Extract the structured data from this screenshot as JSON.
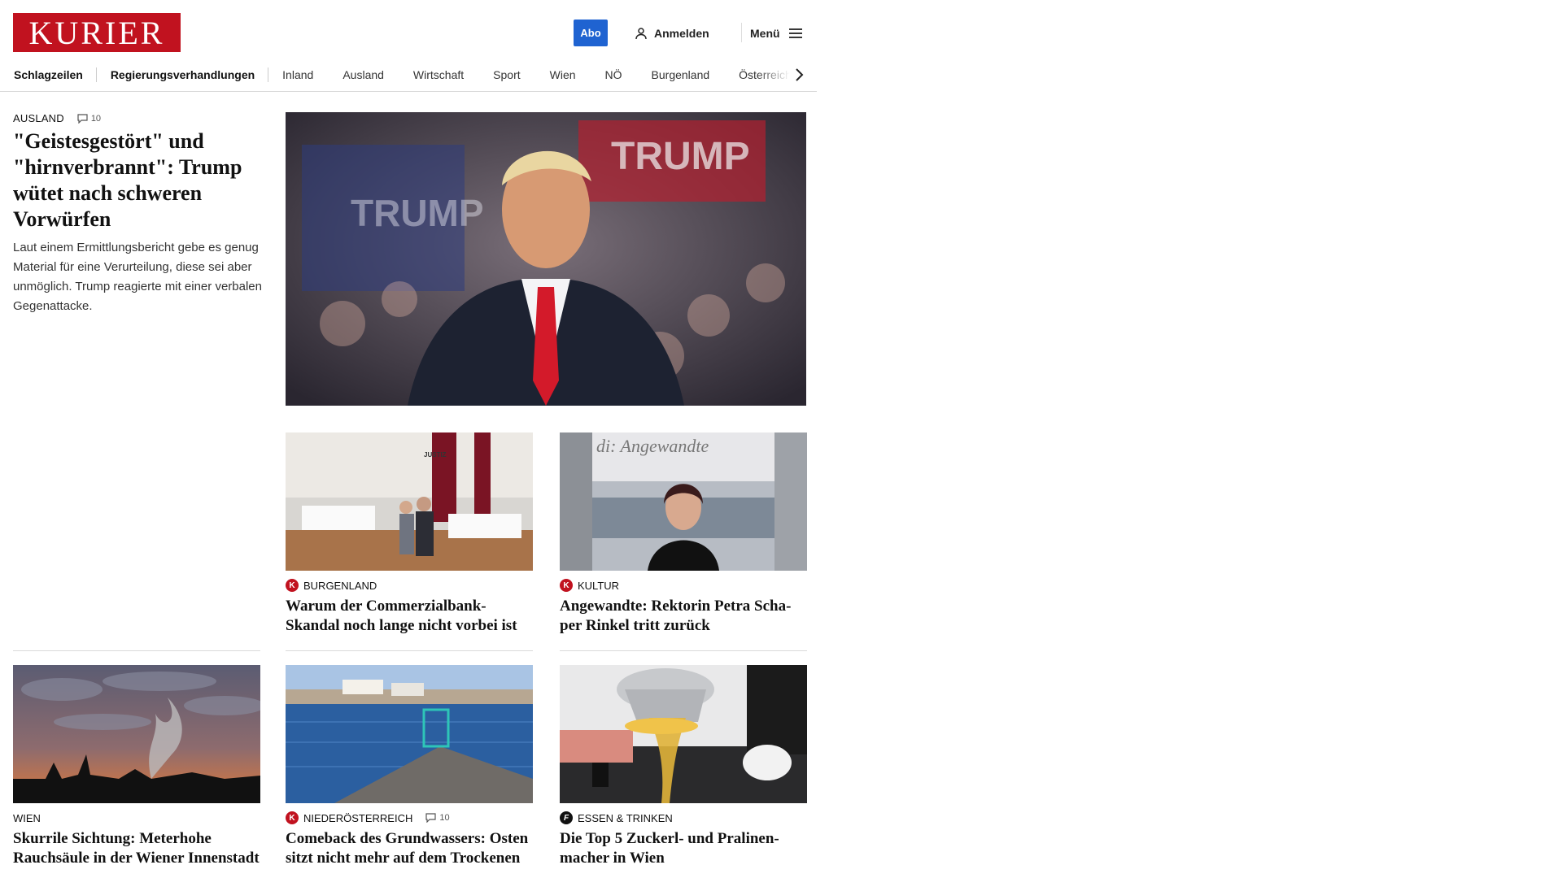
{
  "header": {
    "logo_text": "KURIER",
    "abo_label": "Abo",
    "login_label": "Anmelden",
    "menu_label": "Menü"
  },
  "nav": {
    "items": [
      "Schlagzeilen",
      "Regierungsverhandlungen",
      "Inland",
      "Ausland",
      "Wirtschaft",
      "Sport",
      "Wien",
      "NÖ",
      "Burgenland",
      "Österreich"
    ]
  },
  "lead": {
    "category": "AUSLAND",
    "comments": "10",
    "title": "\"Geistesgestört\" und \"hirnverbrannt\": Trump wütet nach schweren Vorwürfen",
    "teaser": "Laut einem Ermittlungsbericht gebe es genug Material für eine Verurteilung, diese sei aber unmöglich. Trump reagierte mit einer verbalen Gegenattacke."
  },
  "cards": [
    {
      "category": "BURGENLAND",
      "badge": "K",
      "title": "Warum der Commerzialbank-Skandal noch lange nicht vorbei ist"
    },
    {
      "category": "KULTUR",
      "badge": "K",
      "title": "Angewandte: Rektorin Petra Scha­per Rinkel tritt zurück"
    },
    {
      "category": "WIEN",
      "title": "Skurrile Sichtung: Meterhohe Rauchsäule in der Wiener Innenstadt"
    },
    {
      "category": "NIEDERÖSTERREICH",
      "badge": "K",
      "comments": "10",
      "title": "Comeback des Grundwassers: Os­ten sitzt nicht mehr auf dem Trockenen"
    },
    {
      "category": "ESSEN & TRINKEN",
      "badge": "f",
      "title": "Die Top 5 Zuckerl- und Pralinen­macher in Wien"
    }
  ],
  "image_text": {
    "justiz_sign": "JUSTIZ",
    "angewandte_sign": "di: Angewandte"
  },
  "colors": {
    "brand": "#c1121f",
    "abo": "#1f63d1"
  }
}
